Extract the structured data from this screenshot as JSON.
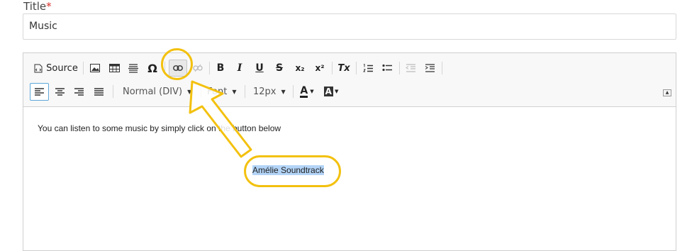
{
  "form": {
    "title_label": "Title",
    "required_mark": "*",
    "title_value": "Music"
  },
  "toolbar": {
    "source_label": "Source",
    "format_combo": "Normal (DIV)",
    "font_combo": "Font",
    "size_combo": "12px",
    "text_color_label": "A",
    "bg_color_label": "A",
    "omega_label": "Ω",
    "bold_label": "B",
    "italic_label": "I",
    "underline_label": "U",
    "strike_label": "S",
    "subscript_label": "x₂",
    "superscript_label": "x²",
    "remove_format_label": "Tx"
  },
  "content": {
    "paragraph": "You can listen to some music by simply click on the button below",
    "selected_text": "Amélie Soundtrack"
  },
  "colors": {
    "highlight": "#f3c10f",
    "selection": "#b3d4f7",
    "required": "#d9302a"
  }
}
